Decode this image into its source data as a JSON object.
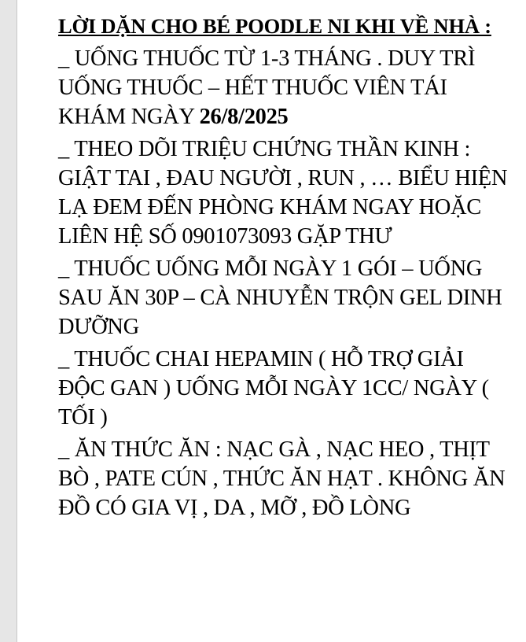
{
  "document": {
    "title": "LỜI DẶN CHO BÉ POODLE NI KHI VỀ NHÀ :",
    "items": [
      {
        "text": "_ UỐNG THUỐC TỪ 1-3 THÁNG . DUY TRÌ UỐNG THUỐC – HẾT THUỐC VIÊN TÁI KHÁM NGÀY ",
        "bold_suffix": "26/8/2025"
      },
      {
        "text": "_ THEO DÕI TRIỆU CHỨNG THẦN KINH : GIẬT TAI , ĐAU NGƯỜI , RUN , … BIỂU HIỆN LẠ ĐEM ĐẾN PHÒNG KHÁM NGAY HOẶC LIÊN HỆ SỐ 0901073093 GẶP THƯ"
      },
      {
        "text": "_ THUỐC UỐNG MỖI NGÀY 1 GÓI – UỐNG SAU ĂN 30P – CÀ NHUYỄN TRỘN GEL DINH DƯỠNG"
      },
      {
        "text": "_ THUỐC CHAI HEPAMIN ( HỖ TRỢ GIẢI ĐỘC GAN ) UỐNG MỖI NGÀY 1CC/ NGÀY ( TỐI )"
      },
      {
        "text": "_ ĂN THỨC ĂN : NẠC GÀ , NẠC HEO , THỊT BÒ , PATE CÚN , THỨC ĂN HẠT . KHÔNG ĂN ĐỒ CÓ GIA VỊ , DA , MỠ , ĐỒ LÒNG"
      }
    ]
  }
}
